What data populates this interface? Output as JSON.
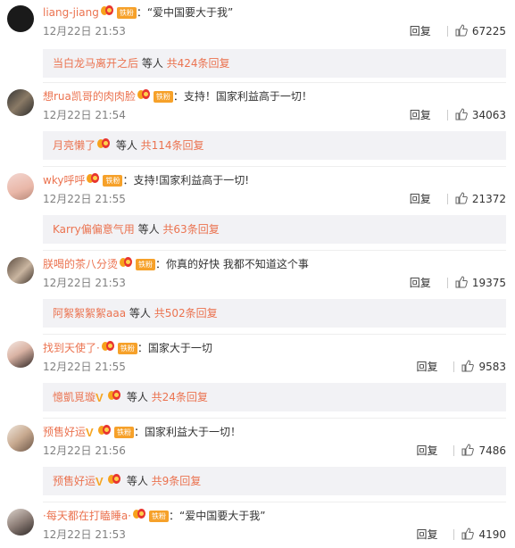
{
  "comments": [
    {
      "user": "liang-jiang",
      "text": "“爱中国要大于我”",
      "badges": [
        "vip",
        "fan"
      ],
      "time": "12月22日 21:53",
      "reply_label": "回复",
      "likes": "67225",
      "sub": {
        "user": "当白龙马离开之后",
        "badges": [],
        "mid": " 等人 ",
        "total": "共424条回复"
      }
    },
    {
      "user": "想rua凯哥的肉肉脸",
      "text": "支持！国家利益高于一切！",
      "badges": [
        "vip",
        "fan"
      ],
      "time": "12月22日 21:54",
      "reply_label": "回复",
      "likes": "34063",
      "sub": {
        "user": "月亮懒了",
        "badges": [
          "vip"
        ],
        "mid": " 等人 ",
        "total": "共114条回复"
      }
    },
    {
      "user": "wky呼呼",
      "text": "支持!国家利益高于一切!",
      "badges": [
        "vip",
        "fan"
      ],
      "time": "12月22日 21:55",
      "reply_label": "回复",
      "likes": "21372",
      "sub": {
        "user": "Karry偏偏意气用",
        "badges": [],
        "mid": " 等人 ",
        "total": "共63条回复"
      }
    },
    {
      "user": "朕喝的茶八分烫",
      "text": "你真的好快 我都不知道这个事",
      "badges": [
        "vip",
        "fan"
      ],
      "time": "12月22日 21:53",
      "reply_label": "回复",
      "likes": "19375",
      "sub": {
        "user": "阿絮絮絮絮aaa",
        "badges": [],
        "mid": " 等人 ",
        "total": "共502条回复"
      }
    },
    {
      "user": "找到天使了·",
      "text": "国家大于一切",
      "badges": [
        "vip",
        "fan"
      ],
      "time": "12月22日 21:55",
      "reply_label": "回复",
      "likes": "9583",
      "sub": {
        "user": "憶凱覓璇",
        "badges": [
          "v",
          "vip"
        ],
        "mid": " 等人 ",
        "total": "共24条回复"
      }
    },
    {
      "user": "预售好运",
      "text": "国家利益大于一切！",
      "badges": [
        "v",
        "vip",
        "fan"
      ],
      "time": "12月22日 21:56",
      "reply_label": "回复",
      "likes": "7486",
      "sub": {
        "user": "预售好运",
        "badges": [
          "v",
          "vip"
        ],
        "mid": " 等人 ",
        "total": "共9条回复"
      }
    },
    {
      "user": "·每天都在打瞌睡a·",
      "text": "“爱中国要大于我”",
      "badges": [
        "vip",
        "fan"
      ],
      "time": "12月22日 21:53",
      "reply_label": "回复",
      "likes": "4190",
      "sub": null
    }
  ],
  "badge_labels": {
    "fan": "铁粉"
  },
  "colors": {
    "username": "#eb7350",
    "meta": "#808080",
    "reply_bg": "#f2f2f5",
    "fan_badge": "#f6a12a"
  }
}
